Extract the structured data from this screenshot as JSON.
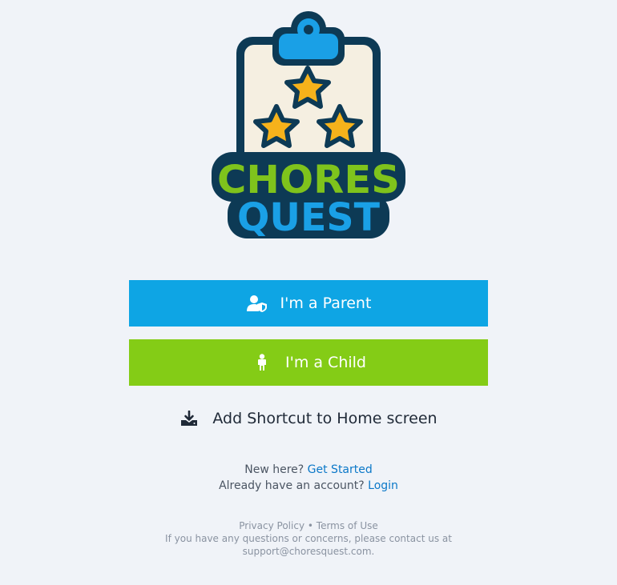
{
  "logo": {
    "line1": "CHORES",
    "line2": "QUEST",
    "colors": {
      "outline": "#0d3a55",
      "clipboard": "#f5efe1",
      "clip": "#0ea5e4",
      "star": "#f6b21b",
      "chores": "#7fc31c",
      "quest": "#1aa0e6"
    }
  },
  "buttons": {
    "parent": {
      "label": "I'm a Parent",
      "icon": "parent-shield-icon",
      "color": "#0ea5e4"
    },
    "child": {
      "label": "I'm a Child",
      "icon": "child-icon",
      "color": "#84cc16"
    }
  },
  "shortcut": {
    "label": "Add Shortcut to Home screen",
    "icon": "download-icon"
  },
  "auth": {
    "new_prefix": "New here?",
    "get_started": "Get Started",
    "account_prefix": "Already have an account?",
    "login": "Login"
  },
  "footer": {
    "privacy": "Privacy Policy",
    "separator": "•",
    "terms": "Terms of Use",
    "contact_line": "If you have any questions or concerns, please contact us at",
    "email": "support@choresquest.com."
  }
}
